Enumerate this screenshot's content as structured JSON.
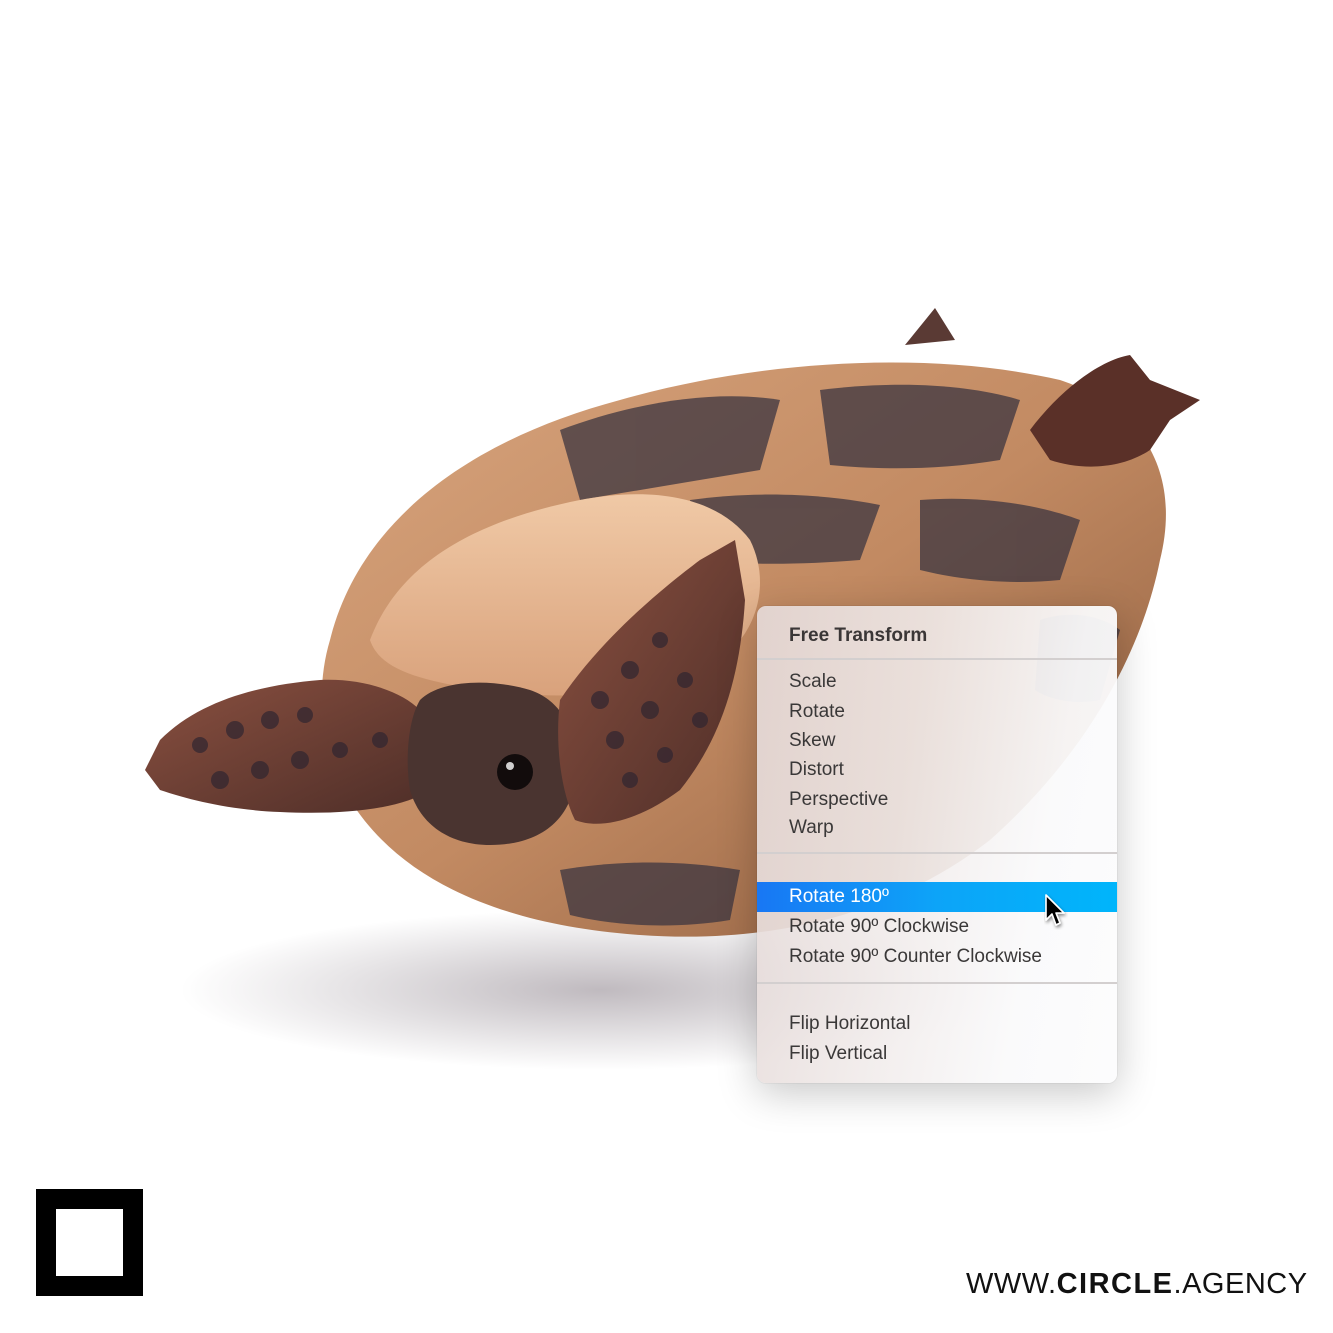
{
  "menu": {
    "header": "Free Transform",
    "group1": [
      "Scale",
      "Rotate",
      "Skew",
      "Distort",
      "Perspective",
      "Warp"
    ],
    "group2": [
      "Rotate 180º",
      "Rotate 90º Clockwise",
      "Rotate 90º Counter Clockwise"
    ],
    "group3": [
      "Flip Horizontal",
      "Flip Vertical"
    ],
    "selected_item": "Rotate 180º",
    "highlight_color_start": "#1877f4",
    "highlight_color_end": "#00b5fb"
  },
  "photo": {
    "subject": "upside-down tortoise"
  },
  "branding": {
    "logo": "square-outline-logo",
    "website_prefix": "WWW.",
    "website_bold": "CIRCLE",
    "website_suffix": ".AGENCY"
  }
}
